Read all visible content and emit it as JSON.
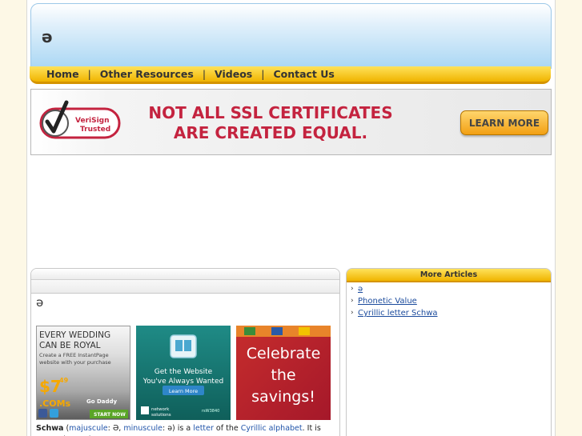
{
  "site": {
    "title": "ə"
  },
  "nav": {
    "items": [
      "Home",
      "Other Resources",
      "Videos",
      "Contact Us"
    ],
    "separator": "|"
  },
  "ssl_banner": {
    "logo_text_1": "VeriSign",
    "logo_text_2": "Trusted",
    "headline_line1": "NOT ALL SSL CERTIFICATES",
    "headline_line2": "ARE CREATED EQUAL.",
    "cta_label": "LEARN MORE"
  },
  "article": {
    "title": "ə",
    "body_prefix_bold": "Schwa",
    "body_text": {
      "p1": " (",
      "link1": "majuscule",
      "p2": ": Ə, ",
      "link2": "minuscule",
      "p3": ": ə) is a ",
      "link3": "letter",
      "p4": " of the ",
      "link4": "Cyrillic alphabet",
      "p5": ". It is currently used"
    }
  },
  "ads": {
    "wedding": {
      "line1": "EVERY WEDDING",
      "line2": "CAN BE ROYAL",
      "line3": "Create a FREE InstantPage",
      "line4": "website with your purchase",
      "price_big": "$7",
      "price_cents": "49",
      "price_suffix": ".COMs",
      "brand": "Go Daddy",
      "cta": "START NOW"
    },
    "network": {
      "line1": "Get the Website",
      "line2": "You've Always Wanted",
      "cta": "Learn More",
      "brand1": "network",
      "brand2": "solutions",
      "small": "rsW3840"
    },
    "celebrate": {
      "line1": "Celebrate",
      "line2": "the",
      "line3": "savings!"
    }
  },
  "more_articles": {
    "header": "More Articles",
    "items": [
      "ə",
      "Phonetic Value",
      "Cyrillic letter Schwa"
    ]
  },
  "colors": {
    "nav_gold": "#f0b400",
    "header_blue": "#aad7f4",
    "headline_red": "#c4233f",
    "link_blue": "#1a4a9c"
  }
}
